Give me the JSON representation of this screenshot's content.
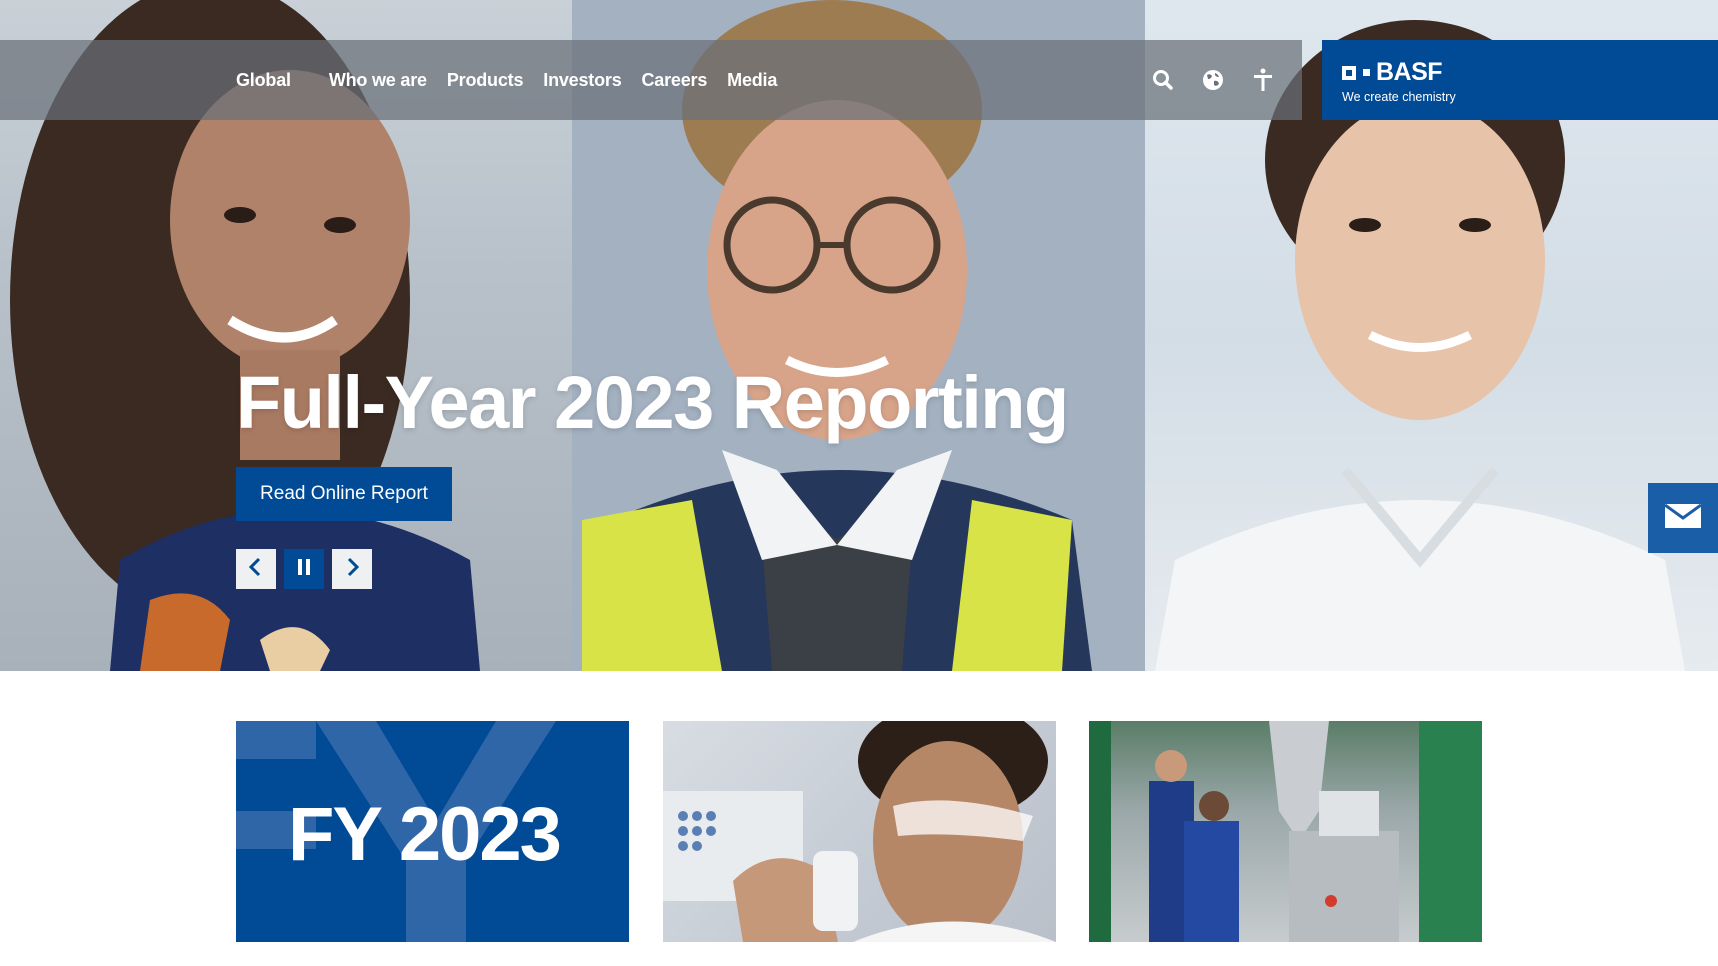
{
  "colors": {
    "brand_blue": "#004a96",
    "nav_overlay": "#697078",
    "white": "#ffffff"
  },
  "nav": {
    "items": [
      "Global",
      "Who we are",
      "Products",
      "Investors",
      "Careers",
      "Media"
    ],
    "icons": [
      "search-icon",
      "globe-icon",
      "accessibility-icon"
    ]
  },
  "logo": {
    "name": "BASF",
    "tagline": "We create chemistry"
  },
  "hero": {
    "headline": "Full-Year 2023 Reporting",
    "cta_label": "Read Online Report",
    "controls": [
      "chevron-left-icon",
      "pause-icon",
      "chevron-right-icon"
    ]
  },
  "side": {
    "contact_icon": "mail-icon"
  },
  "tiles": [
    {
      "text": "FY 2023"
    },
    {
      "image": "scientist-with-safety-glasses"
    },
    {
      "image": "engineers-at-lab-machinery"
    }
  ]
}
